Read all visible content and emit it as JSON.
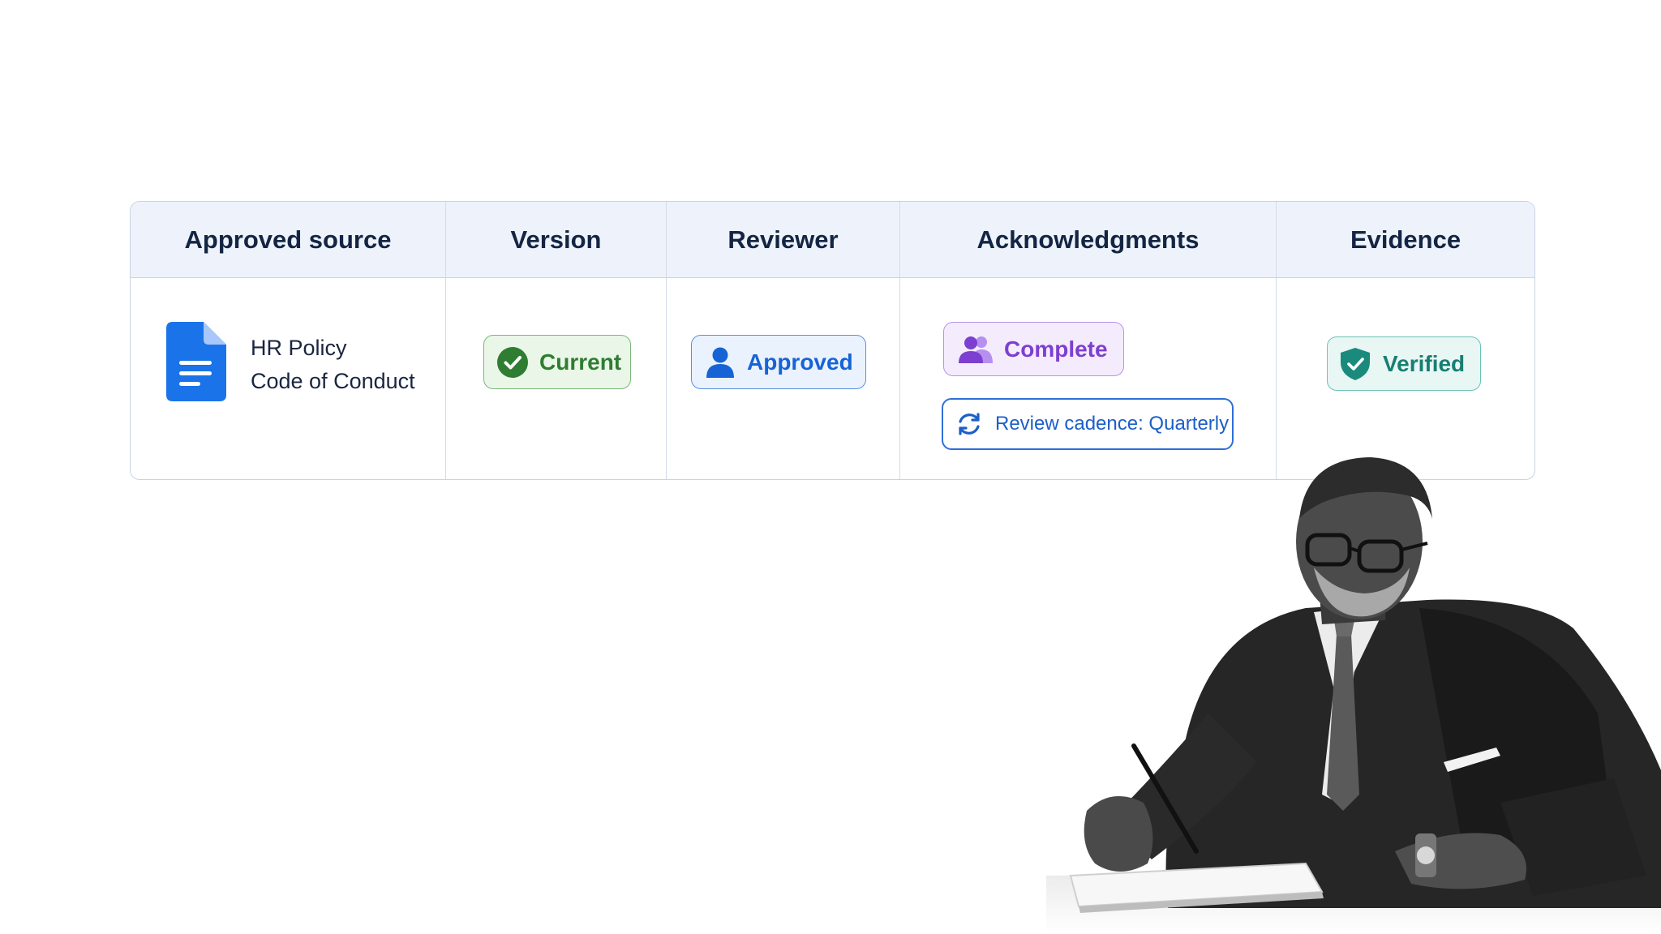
{
  "table": {
    "headers": [
      "Approved source",
      "Version",
      "Reviewer",
      "Acknowledgments",
      "Evidence"
    ],
    "source": {
      "icon": "document-icon",
      "line1": "HR Policy",
      "line2": "Code of Conduct"
    },
    "version": {
      "label": "Current",
      "icon": "check-circle-icon"
    },
    "reviewer": {
      "label": "Approved",
      "icon": "person-icon"
    },
    "acknowledgments": {
      "status": {
        "label": "Complete",
        "icon": "people-icon"
      },
      "cadence": {
        "label": "Review cadence: Quarterly",
        "icon": "refresh-icon"
      }
    },
    "evidence": {
      "label": "Verified",
      "icon": "shield-check-icon"
    }
  },
  "colors": {
    "header_bg": "#eef3fb",
    "border": "#c9d3e3",
    "doc_blue": "#1a73e8",
    "current_green": "#2f7d32",
    "approved_blue": "#1763d6",
    "complete_purple": "#7d3fd0",
    "verified_teal": "#177f72"
  }
}
